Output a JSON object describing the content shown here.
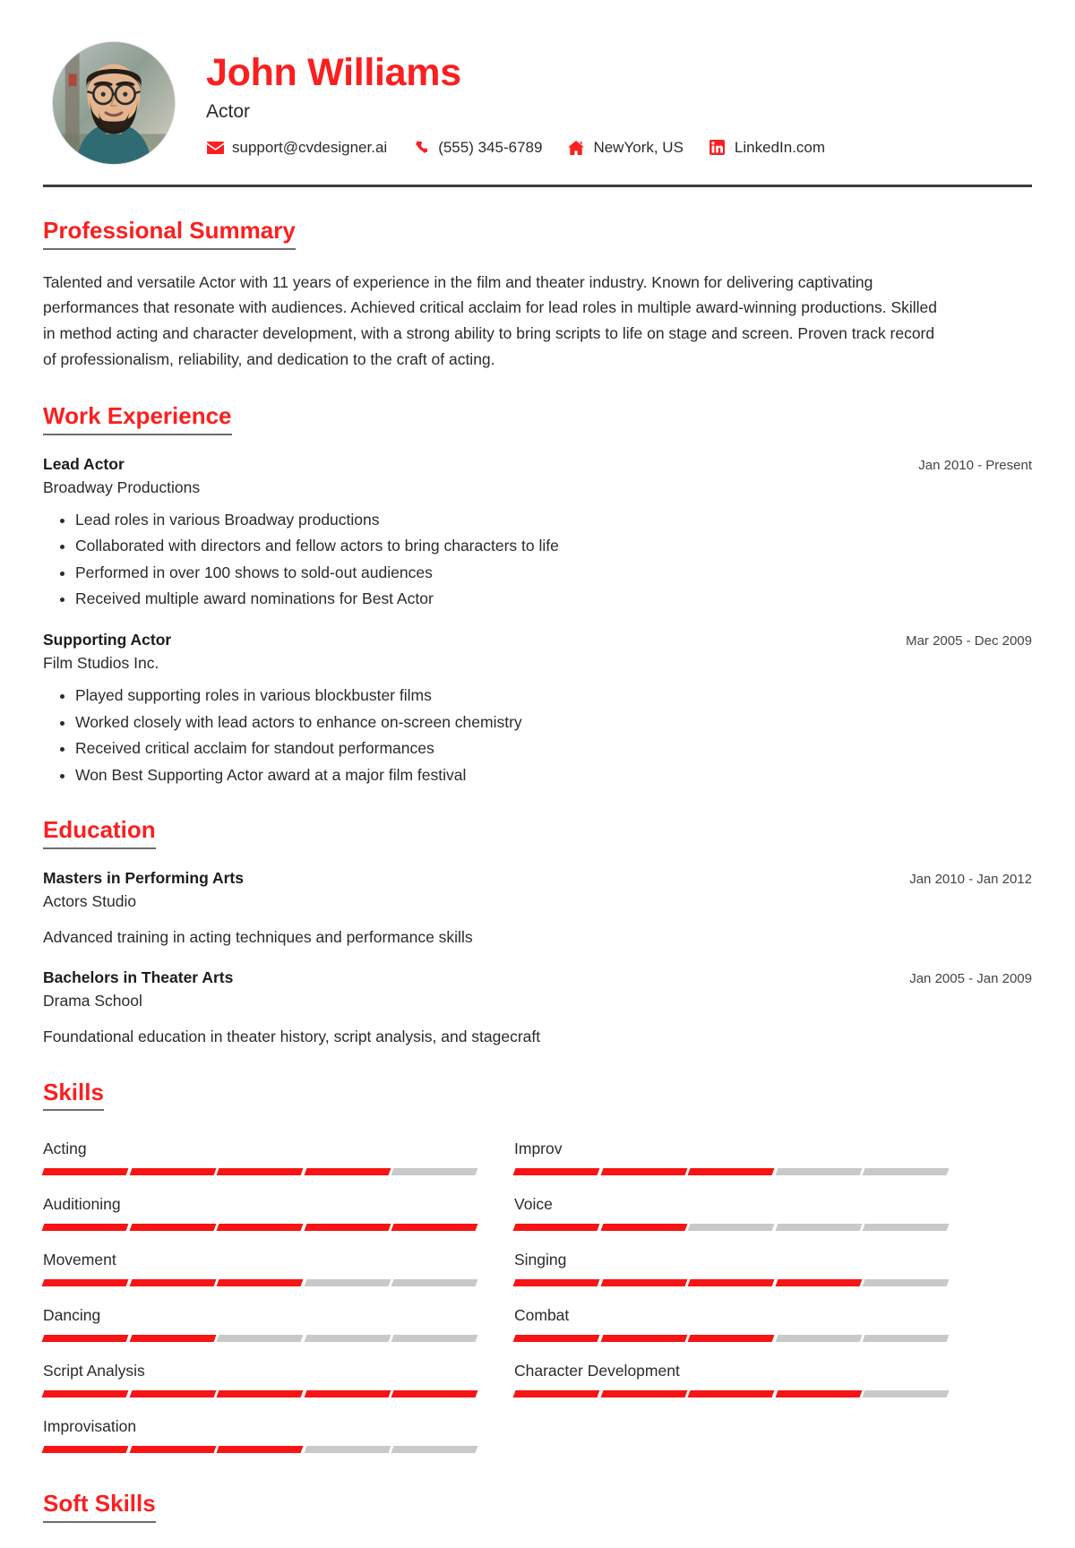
{
  "header": {
    "name": "John Williams",
    "title": "Actor",
    "avatar_alt": "profile-photo",
    "contacts": [
      {
        "icon": "envelope-icon",
        "label": "support@cvdesigner.ai"
      },
      {
        "icon": "phone-icon",
        "label": "(555) 345-6789"
      },
      {
        "icon": "home-icon",
        "label": "NewYork, US"
      },
      {
        "icon": "linkedin-icon",
        "label": "LinkedIn.com"
      }
    ]
  },
  "colors": {
    "accent": "#fb1f1f",
    "bar_filled": "#f71414",
    "bar_empty": "#c9c9c9",
    "rule": "#3c3c3c",
    "text": "#2b2b2b"
  },
  "sections": {
    "summary": {
      "title": "Professional Summary",
      "text": "Talented and versatile Actor with 11 years of experience in the film and theater industry. Known for delivering captivating performances that resonate with audiences. Achieved critical acclaim for lead roles in multiple award-winning productions. Skilled in method acting and character development, with a strong ability to bring scripts to life on stage and screen. Proven track record of professionalism, reliability, and dedication to the craft of acting."
    },
    "work": {
      "title": "Work Experience",
      "entries": [
        {
          "role": "Lead Actor",
          "org": "Broadway Productions",
          "date": "Jan 2010 - Present",
          "bullets": [
            "Lead roles in various Broadway productions",
            "Collaborated with directors and fellow actors to bring characters to life",
            "Performed in over 100 shows to sold-out audiences",
            "Received multiple award nominations for Best Actor"
          ]
        },
        {
          "role": "Supporting Actor",
          "org": "Film Studios Inc.",
          "date": "Mar 2005 - Dec 2009",
          "bullets": [
            "Played supporting roles in various blockbuster films",
            "Worked closely with lead actors to enhance on-screen chemistry",
            "Received critical acclaim for standout performances",
            "Won Best Supporting Actor award at a major film festival"
          ]
        }
      ]
    },
    "education": {
      "title": "Education",
      "entries": [
        {
          "degree": "Masters in Performing Arts",
          "school": "Actors Studio",
          "date": "Jan 2010 - Jan 2012",
          "desc": "Advanced training in acting techniques and performance skills"
        },
        {
          "degree": "Bachelors in Theater Arts",
          "school": "Drama School",
          "date": "Jan 2005 - Jan 2009",
          "desc": "Foundational education in theater history, script analysis, and stagecraft"
        }
      ]
    },
    "skills": {
      "title": "Skills",
      "max_level": 5,
      "items": [
        {
          "name": "Acting",
          "level": 4
        },
        {
          "name": "Improv",
          "level": 3
        },
        {
          "name": "Auditioning",
          "level": 5
        },
        {
          "name": "Voice",
          "level": 2
        },
        {
          "name": "Movement",
          "level": 3
        },
        {
          "name": "Singing",
          "level": 4
        },
        {
          "name": "Dancing",
          "level": 2
        },
        {
          "name": "Combat",
          "level": 3
        },
        {
          "name": "Script Analysis",
          "level": 5
        },
        {
          "name": "Character Development",
          "level": 4
        },
        {
          "name": "Improvisation",
          "level": 3
        }
      ]
    },
    "soft_skills": {
      "title": "Soft Skills"
    }
  }
}
